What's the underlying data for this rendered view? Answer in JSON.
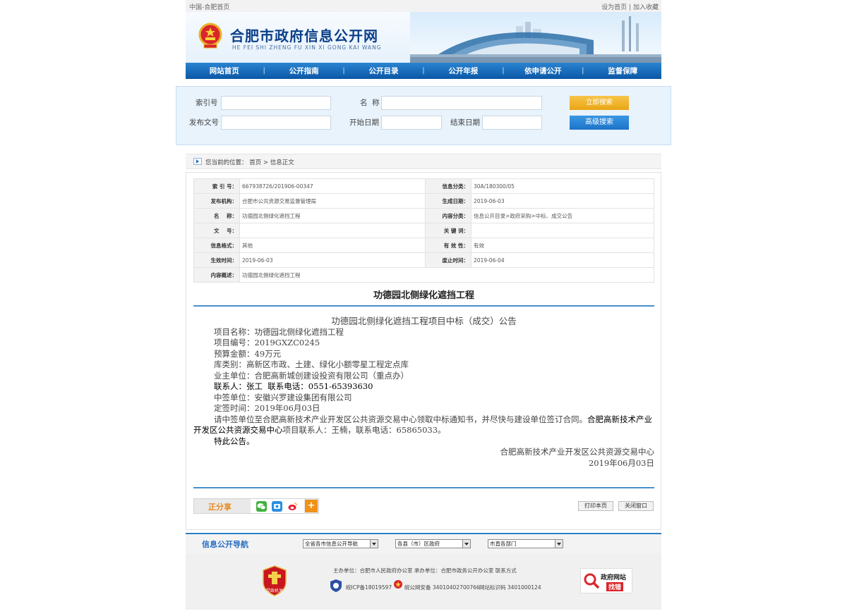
{
  "topbar": {
    "left": "中国-合肥首页",
    "set_home": "设为首页",
    "divider": "|",
    "favorite": "加入收藏"
  },
  "header": {
    "title": "合肥市政府信息公开网",
    "pinyin": "HE FEI SHI ZHENG FU XIN XI GONG KAI WANG"
  },
  "nav": {
    "items": [
      "网站首页",
      "公开指南",
      "公开目录",
      "公开年报",
      "依申请公开",
      "监督保障"
    ],
    "separator": "|"
  },
  "search": {
    "index_label": "索引号",
    "name_label": "名  称",
    "doc_label": "发布文号",
    "start_label": "开始日期",
    "end_label": "结束日期",
    "search_button": "立即搜索",
    "advanced_button": "高级搜索"
  },
  "location": {
    "prefix": "您当前的位置：",
    "home": "首页",
    "arrow": ">",
    "current": "信息正文"
  },
  "meta": {
    "rows": [
      {
        "k1": "索 引 号：",
        "v1": "667938726/201906-00347",
        "k2": "信息分类：",
        "v2": "30A/180300/05"
      },
      {
        "k1": "发布机构：",
        "v1": "合肥市公共资源交易监督管理局",
        "k2": "生成日期：",
        "v2": "2019-06-03"
      },
      {
        "k1": "名    称：",
        "v1": "功德园北侧绿化遮挡工程",
        "k2": "内容分类：",
        "v2": "信息公开目录>政府采购>中标、成交公告"
      },
      {
        "k1": "文    号：",
        "v1": "",
        "k2": "关 键 词：",
        "v2": ""
      },
      {
        "k1": "信息格式：",
        "v1": "其他",
        "k2": "有 效 性：",
        "v2": "有效"
      },
      {
        "k1": "生效时间：",
        "v1": "2019-06-03",
        "k2": "废止时间：",
        "v2": "2019-06-04"
      }
    ],
    "summary_key": "内容概述：",
    "summary_value": "功德园北侧绿化遮挡工程"
  },
  "article": {
    "title": "功德园北侧绿化遮挡工程",
    "heading": "功德园北侧绿化遮挡工程项目中标（成交）公告",
    "lines": [
      "项目名称：功德园北侧绿化遮挡工程",
      "项目编号：2019GXZC0245",
      "预算金额：49万元",
      "库类别：高新区市政、土建、绿化小额零星工程定点库",
      "业主单位：合肥高新城创建设投资有限公司（重点办）"
    ],
    "contact": "联系人：张工  联系电话：0551-65393630",
    "lines2": [
      "中签单位：安徽兴罗建设集团有限公司",
      "定签时间：2019年06月03日"
    ],
    "notice_part1": "请中签单位至合肥高新技术产业开发区公共资源交易中心领取中标通知书，并尽快与建设单位签订合同。",
    "notice_center": "合肥高新技术产业开发区公共资源交易中心",
    "notice_part2": "项目联系人：王楠，联系电话：65865033。",
    "closing": "特此公告。",
    "sign_org": "合肥高新技术产业开发区公共资源交易中心",
    "sign_date": "2019年06月03日"
  },
  "share": {
    "label": "正分享",
    "more": "+"
  },
  "tools": {
    "print": "打印本页",
    "close": "关闭窗口"
  },
  "footer_nav": {
    "title": "信息公开导航",
    "select1": "全省各市信息公开导航",
    "select2": "各县（市）区政府",
    "select3": "市直各部门"
  },
  "footer": {
    "line1": "主办单位：合肥市人民政府办公室  承办单位：合肥市政务公开办公室  联系方式",
    "icp": "皖ICP备18019597",
    "police": "皖公网安备 34010402700766",
    "site_code": "网站标识码 3401000124",
    "badge_text": "党政机关",
    "gov_find_title": "政府网站",
    "gov_find_sub": "找错"
  },
  "colors": {
    "nav_blue": "#0a57a6",
    "accent_blue": "#2a7fc9",
    "search_yellow": "#e9a514",
    "title_navy": "#0b3f8a"
  }
}
